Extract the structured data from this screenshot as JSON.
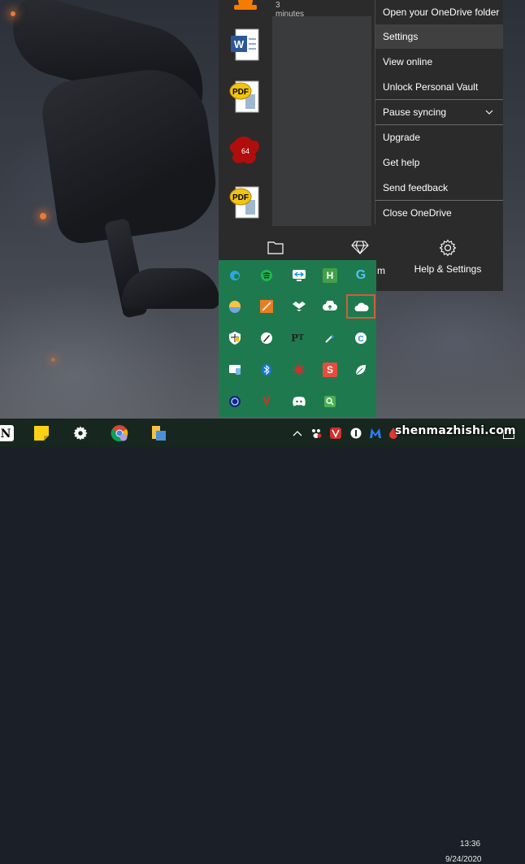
{
  "recent_files": {
    "timestamp": "3 minutes ago",
    "badge_number": "64"
  },
  "onedrive_menu": {
    "items": [
      {
        "label": "Open your OneDrive folder"
      },
      {
        "label": "Settings"
      },
      {
        "label": "View online"
      },
      {
        "label": "Unlock Personal Vault"
      },
      {
        "label": "Pause syncing"
      },
      {
        "label": "Upgrade"
      },
      {
        "label": "Get help"
      },
      {
        "label": "Send feedback"
      },
      {
        "label": "Close OneDrive"
      }
    ],
    "hovered_item": "Settings"
  },
  "onedrive_bottom": {
    "partial_label": "m",
    "help_settings_label": "Help & Settings"
  },
  "tray_icons": [
    "edge-icon",
    "spotify-icon",
    "teamviewer-icon",
    "h-app-icon",
    "g-app-icon",
    "weather-icon",
    "orange-app-icon",
    "dropbox-icon",
    "cloud-upload-icon",
    "onedrive-icon",
    "security-icon",
    "pen-icon",
    "pt-icon",
    "qbittorrent-icon",
    "c-app-icon",
    "monitor-icon",
    "bluetooth-icon",
    "red-app-icon",
    "s-app-icon",
    "leaf-icon",
    "circle-app-icon",
    "vivaldi-icon",
    "discord-icon",
    "search-app-icon"
  ],
  "taskbar": {
    "notion_letter": "N",
    "time": "13:36",
    "date": "9/24/2020",
    "watermark": "shenmazhishi.com"
  },
  "colors": {
    "tray_bg": "#1e7a4e",
    "menu_bg": "#2b2b2b",
    "highlight": "#d65a3c"
  }
}
